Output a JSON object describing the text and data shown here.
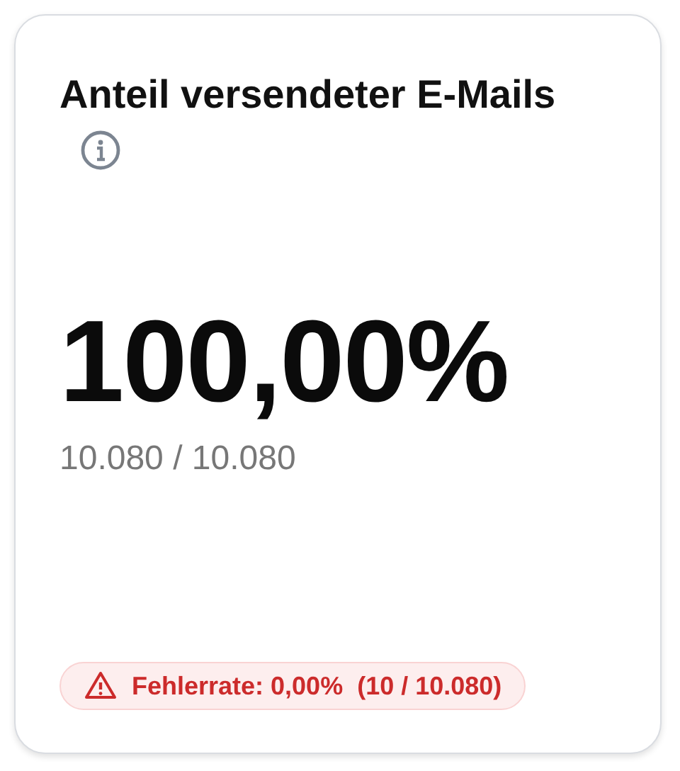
{
  "card": {
    "title": "Anteil versendeter E-Mails",
    "value": "100,00%",
    "detail": "10.080 / 10.080",
    "badge": {
      "kind": "error",
      "text": "Fehlerrate: 0,00%  (10 / 10.080)"
    }
  }
}
